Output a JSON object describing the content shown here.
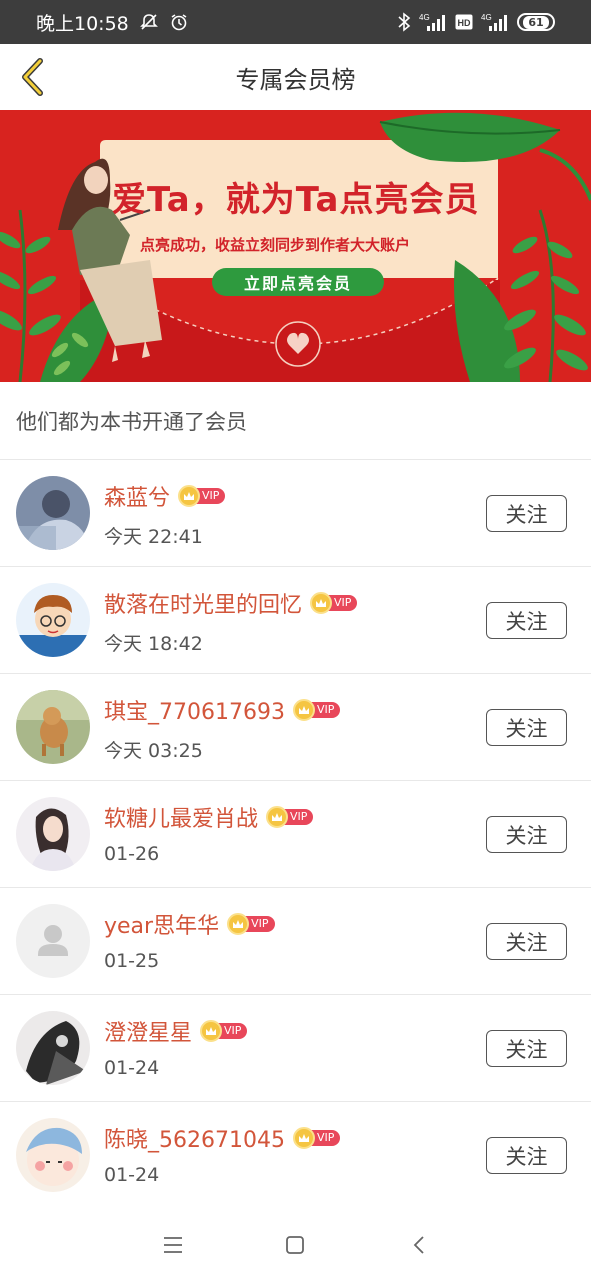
{
  "status_bar": {
    "time": "晚上10:58",
    "network1": "4G",
    "hd": "HD",
    "network2": "4G",
    "battery": "61"
  },
  "header": {
    "title": "专属会员榜"
  },
  "banner": {
    "title": "爱Ta，就为Ta点亮会员",
    "subtitle": "点亮成功，收益立刻同步到作者大大账户",
    "cta": "立即点亮会员"
  },
  "section": {
    "title": "他们都为本书开通了会员"
  },
  "vip_label": "VIP",
  "follow_label": "关注",
  "members": [
    {
      "name": "森蓝兮",
      "time": "今天 22:41"
    },
    {
      "name": "散落在时光里的回忆",
      "time": "今天 18:42"
    },
    {
      "name": "琪宝_770617693",
      "time": "今天 03:25"
    },
    {
      "name": "软糖儿最爱肖战",
      "time": "01-26"
    },
    {
      "name": "year思年华",
      "time": "01-25"
    },
    {
      "name": "澄澄星星",
      "time": "01-24"
    },
    {
      "name": "陈晓_562671045",
      "time": "01-24"
    }
  ],
  "colors": {
    "name": "#d2553a",
    "banner_red": "#d2232a",
    "cta_green": "#2e9a3e",
    "vip_tag": "#e8475a",
    "status_bar": "#3d3d3d"
  }
}
